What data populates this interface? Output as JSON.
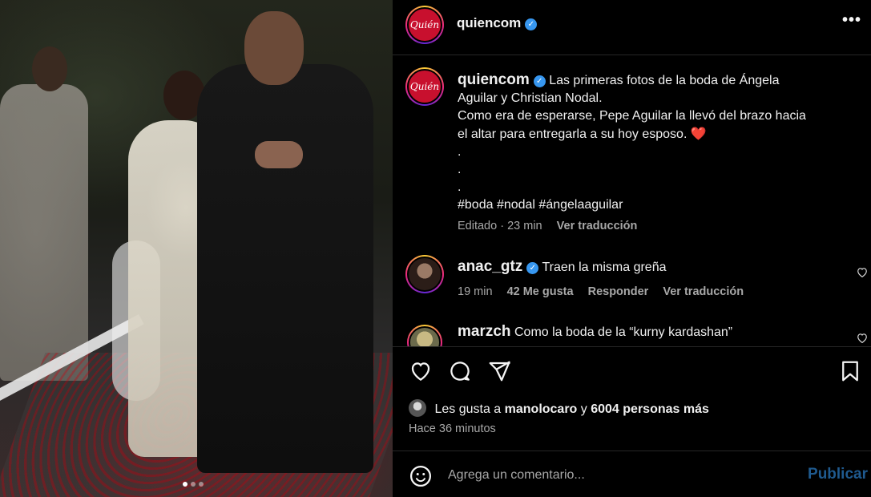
{
  "photo": {
    "alt": "Wedding photo",
    "carousel_dots": 3
  },
  "header": {
    "avatar_text": "Quién",
    "username": "quiencom",
    "verified_mark": "✓",
    "more_label": "•••"
  },
  "caption": {
    "avatar_text": "Quién",
    "username": "quiencom",
    "verified_mark": "✓",
    "line1": "Las primeras fotos de la boda de Ángela",
    "line2": "Aguilar y Christian Nodal.",
    "line3": "Como era de esperarse, Pepe Aguilar la llevó del brazo hacia",
    "line4": "el altar para entregarla a su hoy esposo.",
    "heart": "❤️",
    "dot1": ".",
    "dot2": ".",
    "dot3": ".",
    "hashtags": "#boda #nodal #ángelaaguilar",
    "edited": "Editado",
    "separator": "·",
    "age": "23 min",
    "translate": "Ver traducción"
  },
  "comments": [
    {
      "username": "anac_gtz",
      "verified_mark": "✓",
      "text": "Traen la misma greña",
      "age": "19 min",
      "likes": "42 Me gusta",
      "reply": "Responder",
      "translate": "Ver traducción"
    },
    {
      "username": "marzch",
      "text": "Como la boda de la “kurny kardashan”"
    }
  ],
  "likes": {
    "prefix": "Les gusta a",
    "user": "manolocaro",
    "middle": "y",
    "others": "6004 personas más"
  },
  "posted_time": "Hace 36 minutos",
  "add_comment": {
    "placeholder": "Agrega un comentario...",
    "publish_label": "Publicar"
  },
  "colors": {
    "verified": "#3797f0",
    "publish": "#1f5a8f",
    "heart": "#ed4956"
  }
}
